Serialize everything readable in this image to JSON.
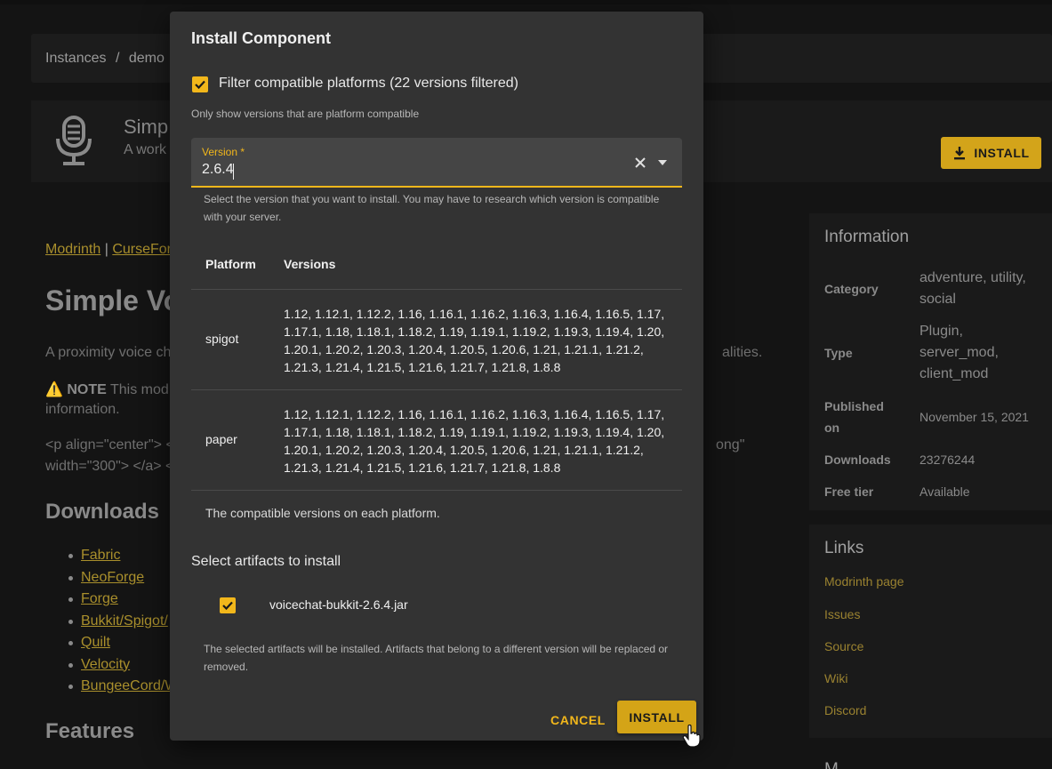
{
  "background": {
    "breadcrumb": [
      "Instances",
      "/",
      "demo"
    ],
    "header": {
      "title": "Simp",
      "subtitle": "A work",
      "install_label": "INSTALL"
    },
    "links_row": {
      "modrinth": "Modrinth",
      "sep": "|",
      "curseforge": "CurseFor"
    },
    "content": {
      "heading": "Simple Vo",
      "para1": "A proximity voice ch",
      "para1_right": "alities.",
      "note_bold": "NOTE",
      "note_text": " This mod",
      "note_text2": "information.",
      "para3": "<p align=\"center\"> <",
      "para3_right": "ong\"",
      "para4": "width=\"300\"> </a> <",
      "downloads_heading": "Downloads",
      "downloads": [
        "Fabric",
        "NeoForge",
        "Forge",
        "Bukkit/Spigot/",
        "Quilt",
        "Velocity",
        "BungeeCord/W"
      ],
      "features_heading": "Features"
    },
    "information": {
      "title": "Information",
      "rows": [
        {
          "key": "Category",
          "value": "adventure, utility, social"
        },
        {
          "key": "Type",
          "value": "Plugin, server_mod, client_mod"
        },
        {
          "key": "Published on",
          "value": "November 15, 2021"
        },
        {
          "key": "Downloads",
          "value": "23276244"
        },
        {
          "key": "Free tier",
          "value": "Available"
        }
      ]
    },
    "links": {
      "title": "Links",
      "items": [
        "Modrinth page",
        "Issues",
        "Source",
        "Wiki",
        "Discord"
      ]
    },
    "more_title": "M..."
  },
  "dialog": {
    "title": "Install Component",
    "filter": {
      "label": "Filter compatible platforms (22 versions filtered)",
      "checked": true,
      "hint": "Only show versions that are platform compatible"
    },
    "version_field": {
      "label": "Version *",
      "value": "2.6.4",
      "hint": "Select the version that you want to install. You may have to research which version is compatible with your server."
    },
    "table": {
      "headers": [
        "Platform",
        "Versions"
      ],
      "rows": [
        {
          "platform": "spigot",
          "versions": "1.12, 1.12.1, 1.12.2, 1.16, 1.16.1, 1.16.2, 1.16.3, 1.16.4, 1.16.5, 1.17, 1.17.1, 1.18, 1.18.1, 1.18.2, 1.19, 1.19.1, 1.19.2, 1.19.3, 1.19.4, 1.20, 1.20.1, 1.20.2, 1.20.3, 1.20.4, 1.20.5, 1.20.6, 1.21, 1.21.1, 1.21.2, 1.21.3, 1.21.4, 1.21.5, 1.21.6, 1.21.7, 1.21.8, 1.8.8"
        },
        {
          "platform": "paper",
          "versions": "1.12, 1.12.1, 1.12.2, 1.16, 1.16.1, 1.16.2, 1.16.3, 1.16.4, 1.16.5, 1.17, 1.17.1, 1.18, 1.18.1, 1.18.2, 1.19, 1.19.1, 1.19.2, 1.19.3, 1.19.4, 1.20, 1.20.1, 1.20.2, 1.20.3, 1.20.4, 1.20.5, 1.20.6, 1.21, 1.21.1, 1.21.2, 1.21.3, 1.21.4, 1.21.5, 1.21.6, 1.21.7, 1.21.8, 1.8.8"
        }
      ],
      "caption": "The compatible versions on each platform."
    },
    "artifacts": {
      "title": "Select artifacts to install",
      "items": [
        {
          "label": "voicechat-bukkit-2.6.4.jar",
          "checked": true
        }
      ],
      "hint": "The selected artifacts will be installed. Artifacts that belong to a different version will be replaced or removed."
    },
    "actions": {
      "cancel": "CANCEL",
      "install": "INSTALL"
    }
  },
  "colors": {
    "accent": "#f2b71b",
    "button": "#d4a417",
    "dialog_bg": "#333333",
    "page_bg": "#141414"
  }
}
